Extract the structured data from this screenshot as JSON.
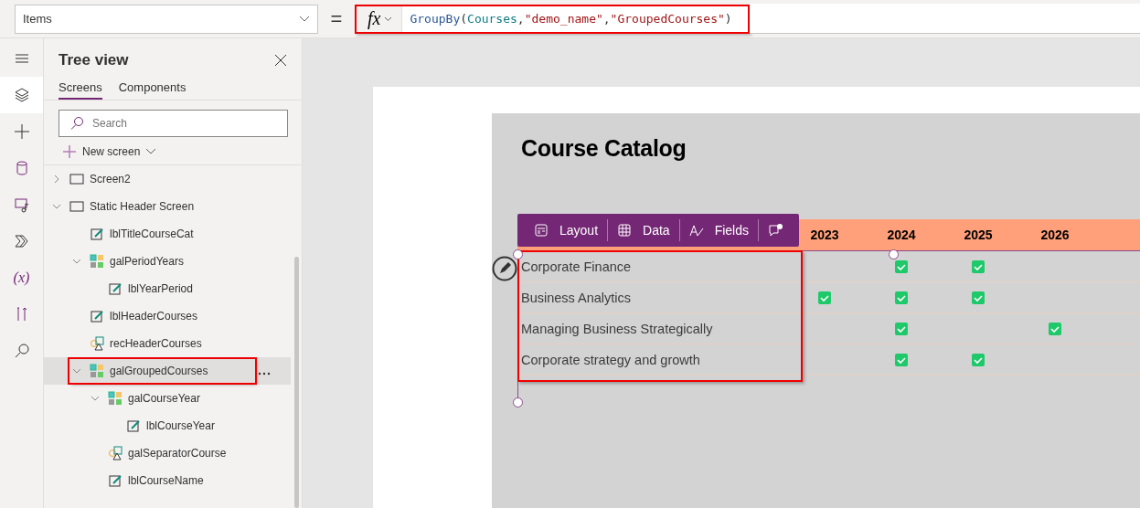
{
  "property_selector": {
    "value": "Items"
  },
  "equals_sign": "=",
  "formula": {
    "fx_label": "fx",
    "tokens": [
      {
        "kind": "function",
        "text": "GroupBy"
      },
      {
        "kind": "punct",
        "text": "("
      },
      {
        "kind": "identifier",
        "text": "Courses"
      },
      {
        "kind": "punct",
        "text": ","
      },
      {
        "kind": "string",
        "text": "\"demo_name\""
      },
      {
        "kind": "punct",
        "text": ","
      },
      {
        "kind": "string",
        "text": "\"GroupedCourses\""
      },
      {
        "kind": "punct",
        "text": ")"
      }
    ]
  },
  "rail": [
    {
      "kind": "menu",
      "selected": false
    },
    {
      "kind": "layers",
      "selected": true
    },
    {
      "kind": "insert",
      "selected": false
    },
    {
      "kind": "data",
      "selected": false
    },
    {
      "kind": "media",
      "selected": false
    },
    {
      "kind": "automate",
      "selected": false
    },
    {
      "kind": "variables",
      "selected": false,
      "glyph": "(x)"
    },
    {
      "kind": "tools",
      "selected": false
    },
    {
      "kind": "search",
      "selected": false
    }
  ],
  "tree_view": {
    "title": "Tree view",
    "tabs": [
      {
        "label": "Screens",
        "selected": true
      },
      {
        "label": "Components",
        "selected": false
      }
    ],
    "search": {
      "placeholder": "Search"
    },
    "new_screen": "New screen",
    "items": [
      {
        "kind": "screen",
        "name": "Screen2",
        "expanded": false,
        "selected": false
      },
      {
        "kind": "screen",
        "name": "Static Header Screen",
        "expanded": true,
        "selected": false,
        "children": [
          {
            "kind": "label",
            "name": "lblTitleCourseCat",
            "selected": false
          },
          {
            "kind": "gallery",
            "name": "galPeriodYears",
            "expanded": true,
            "selected": false,
            "children": [
              {
                "kind": "label",
                "name": "lblYearPeriod",
                "selected": false
              }
            ]
          },
          {
            "kind": "label",
            "name": "lblHeaderCourses",
            "selected": false
          },
          {
            "kind": "shape",
            "name": "recHeaderCourses",
            "selected": false
          },
          {
            "kind": "gallery",
            "name": "galGroupedCourses",
            "expanded": true,
            "selected": true,
            "children": [
              {
                "kind": "gallery",
                "name": "galCourseYear",
                "expanded": true,
                "selected": false,
                "children": [
                  {
                    "kind": "label",
                    "name": "lblCourseYear",
                    "selected": false
                  }
                ]
              },
              {
                "kind": "shape",
                "name": "galSeparatorCourse",
                "selected": false
              },
              {
                "kind": "label",
                "name": "lblCourseName",
                "selected": false
              }
            ]
          }
        ]
      }
    ]
  },
  "app": {
    "title": "Course Catalog",
    "toolbar": [
      {
        "kind": "layout",
        "label": "Layout"
      },
      {
        "kind": "data",
        "label": "Data"
      },
      {
        "kind": "fields",
        "label": "Fields"
      },
      {
        "kind": "comment"
      }
    ],
    "years": [
      "2023",
      "2024",
      "2025",
      "2026"
    ],
    "courses": [
      {
        "name": "Corporate Finance",
        "checks": [
          false,
          true,
          true,
          false
        ]
      },
      {
        "name": "Business Analytics",
        "checks": [
          true,
          true,
          true,
          false
        ]
      },
      {
        "name": "Managing Business Strategically",
        "checks": [
          false,
          true,
          false,
          true
        ]
      },
      {
        "name": "Corporate strategy and growth",
        "checks": [
          false,
          true,
          true,
          false
        ]
      }
    ]
  }
}
